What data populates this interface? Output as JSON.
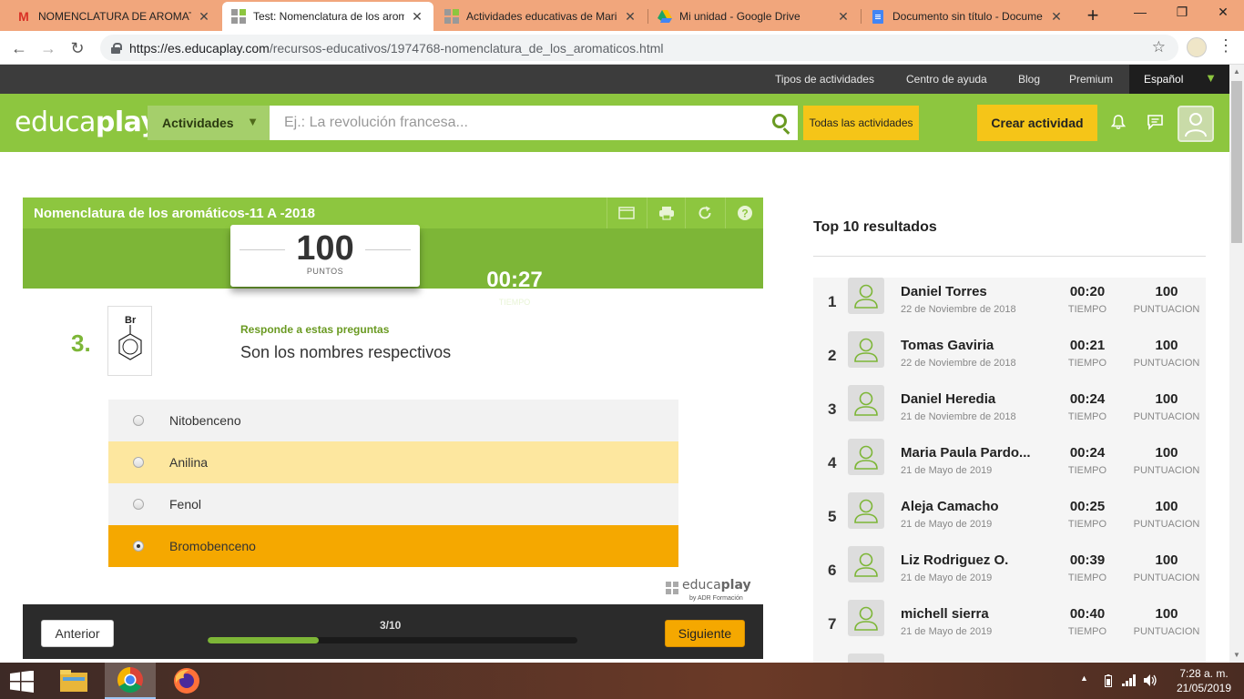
{
  "browser": {
    "tabs": [
      {
        "title": "NOMENCLATURA DE AROMATIC",
        "icon": "gmail-icon",
        "active": false
      },
      {
        "title": "Test: Nomenclatura de los arom",
        "icon": "educaplay-icon",
        "active": true
      },
      {
        "title": "Actividades educativas de Maria",
        "icon": "educaplay-icon",
        "active": false
      },
      {
        "title": "Mi unidad - Google Drive",
        "icon": "drive-icon",
        "active": false
      },
      {
        "title": "Documento sin título - Docume",
        "icon": "docs-icon",
        "active": false
      }
    ],
    "url_host": "https://es.educaplay.com",
    "url_path": "/recursos-educativos/1974768-nomenclatura_de_los_aromaticos.html"
  },
  "site": {
    "topnav": [
      "Tipos de actividades",
      "Centro de ayuda",
      "Blog",
      "Premium"
    ],
    "language": "Español",
    "logo_light": "educa",
    "logo_bold": "play",
    "activities_label": "Actividades",
    "search_placeholder": "Ej.: La revolución francesa...",
    "all_activities_label": "Todas las actividades",
    "create_label": "Crear actividad",
    "colors": {
      "brand_green": "#8dc63f",
      "accent_yellow": "#f5c518",
      "selected_orange": "#f5a800"
    }
  },
  "game": {
    "title": "Nomenclatura de los aromáticos-11 A -2018",
    "score": "100",
    "score_label": "PUNTOS",
    "time": "00:27",
    "time_label": "TIEMPO",
    "question_number": "3.",
    "image_label": "Br",
    "hint": "Responde a estas preguntas",
    "question": "Son los nombres respectivos",
    "answers": [
      {
        "label": "Nitobenceno",
        "state": "normal"
      },
      {
        "label": "Anilina",
        "state": "hover"
      },
      {
        "label": "Fenol",
        "state": "normal"
      },
      {
        "label": "Bromobenceno",
        "state": "selected"
      }
    ],
    "watermark_light": "educa",
    "watermark_bold": "play",
    "watermark_by": "by ADR Formación",
    "prev_label": "Anterior",
    "next_label": "Siguiente",
    "progress_text": "3/10",
    "progress_fraction": 0.3
  },
  "ranking": {
    "title": "Top 10 resultados",
    "time_label": "TIEMPO",
    "score_label": "PUNTUACION",
    "rows": [
      {
        "pos": "1",
        "name": "Daniel Torres",
        "date": "22 de Noviembre de 2018",
        "time": "00:20",
        "score": "100"
      },
      {
        "pos": "2",
        "name": "Tomas Gaviria",
        "date": "22 de Noviembre de 2018",
        "time": "00:21",
        "score": "100"
      },
      {
        "pos": "3",
        "name": "Daniel Heredia",
        "date": "21 de Noviembre de 2018",
        "time": "00:24",
        "score": "100"
      },
      {
        "pos": "4",
        "name": "Maria Paula Pardo...",
        "date": "21 de Mayo de 2019",
        "time": "00:24",
        "score": "100"
      },
      {
        "pos": "5",
        "name": "Aleja Camacho",
        "date": "21 de Mayo de 2019",
        "time": "00:25",
        "score": "100"
      },
      {
        "pos": "6",
        "name": "Liz Rodriguez O.",
        "date": "21 de Mayo de 2019",
        "time": "00:39",
        "score": "100"
      },
      {
        "pos": "7",
        "name": "michell sierra",
        "date": "21 de Mayo de 2019",
        "time": "00:40",
        "score": "100"
      }
    ]
  },
  "taskbar": {
    "time": "7:28 a. m.",
    "date": "21/05/2019"
  }
}
